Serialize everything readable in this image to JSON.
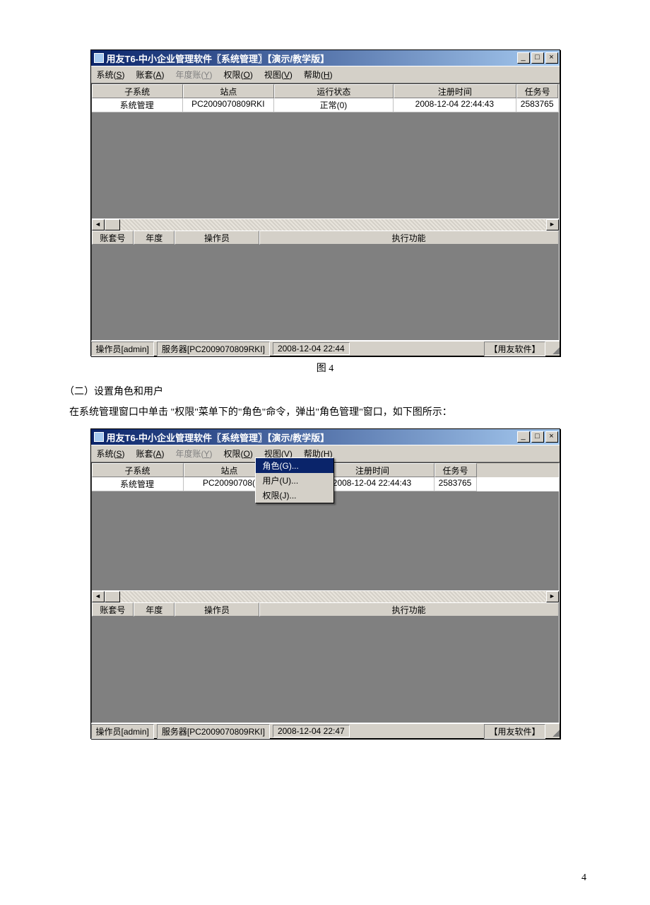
{
  "caption1": "图 4",
  "section_heading": "（二）设置角色和用户",
  "body_line": "在系统管理窗口中单击 \"权限\"菜单下的\"角色\"命令，弹出\"角色管理\"窗口，如下图所示：",
  "page_number": "4",
  "win": {
    "title": "用友T6-中小企业管理软件〖系统管理〗【演示/教学版】",
    "menubar": {
      "system": "系统(",
      "system_u": "S",
      "system2": ")",
      "account": "账套(",
      "account_u": "A",
      "account2": ")",
      "year": "年度账(",
      "year_u": "Y",
      "year2": ")",
      "perm": "权限(",
      "perm_u": "O",
      "perm2": ")",
      "view": "视图(",
      "view_u": "V",
      "view2": ")",
      "help": "帮助(",
      "help_u": "H",
      "help2": ")"
    },
    "dropdown": {
      "role": "角色(",
      "role_u": "G",
      "role2": ")...",
      "user": "用户(",
      "user_u": "U",
      "user2": ")...",
      "perm": "权限(",
      "perm_u": "J",
      "perm2": ")..."
    },
    "top_headers": {
      "subsys": "子系统",
      "site": "站点",
      "state": "运行状态",
      "regtime": "注册时间",
      "task": "任务号"
    },
    "top_row1": {
      "subsys": "系统管理",
      "site": "PC2009070809RKI",
      "state": "正常(0)",
      "regtime": "2008-12-04 22:44:43",
      "task": "2583765"
    },
    "top_row2": {
      "subsys": "系统管理",
      "site": "PC20090708(",
      "state_suffix": ")",
      "regtime": "2008-12-04 22:44:43",
      "task": "2583765"
    },
    "bot_headers": {
      "acc": "账套号",
      "year": "年度",
      "op": "操作员",
      "func": "执行功能"
    },
    "status1": {
      "op": "操作员[admin]",
      "srv": "服务器[PC2009070809RKI]",
      "time": "2008-12-04 22:44",
      "brand": "【用友软件】"
    },
    "status2": {
      "op": "操作员[admin]",
      "srv": "服务器[PC2009070809RKI]",
      "time": "2008-12-04 22:47",
      "brand": "【用友软件】"
    },
    "win_btn": {
      "min": "_",
      "max": "□",
      "close": "×"
    },
    "sb": {
      "left": "◄",
      "right": "►"
    }
  }
}
